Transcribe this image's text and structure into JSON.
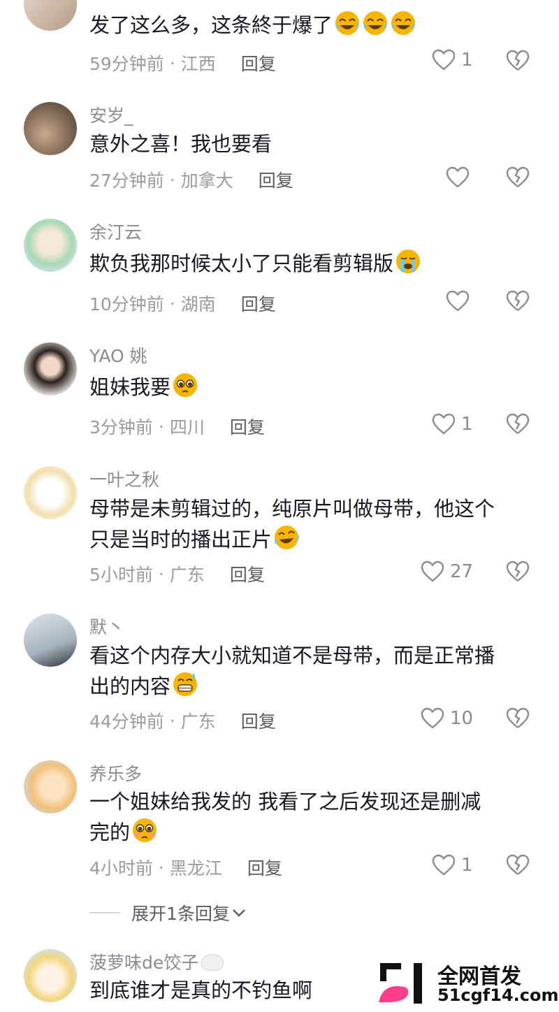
{
  "comments": [
    {
      "name": "",
      "text": "发了这么多，这条終于爆了",
      "time": "59分钟前",
      "location": "江西",
      "reply": "回复",
      "likes": "1",
      "emojis": [
        "laugh-cry",
        "laugh-cry",
        "laugh-cry"
      ]
    },
    {
      "name": "安岁_",
      "text": "意外之喜！我也要看",
      "time": "27分钟前",
      "location": "加拿大",
      "reply": "回复",
      "likes": "",
      "emojis": []
    },
    {
      "name": "余汀云",
      "text": "欺负我那时候太小了只能看剪辑版",
      "time": "10分钟前",
      "location": "湖南",
      "reply": "回复",
      "likes": "",
      "emojis": [
        "crying"
      ]
    },
    {
      "name": "YAO 姚",
      "text": "姐妹我要",
      "time": "3分钟前",
      "location": "四川",
      "reply": "回复",
      "likes": "1",
      "emojis": [
        "pleading"
      ]
    },
    {
      "name": "一叶之秋",
      "text_lines": [
        "母带是未剪辑过的，纯原片叫做母带，他这个",
        "只是当时的播出正片"
      ],
      "time": "5小时前",
      "location": "广东",
      "reply": "回复",
      "likes": "27",
      "emojis": [
        "laugh-tears"
      ]
    },
    {
      "name": "默丶",
      "text_lines": [
        "看这个内存大小就知道不是母带，而是正常播",
        "出的内容"
      ],
      "time": "44分钟前",
      "location": "广东",
      "reply": "回复",
      "likes": "10",
      "emojis": [
        "grin-sweat"
      ]
    },
    {
      "name": "养乐多",
      "text_lines": [
        "一个姐妹给我发的  我看了之后发现还是删减",
        "完的"
      ],
      "time": "4小时前",
      "location": "黑龙江",
      "reply": "回复",
      "likes": "1",
      "emojis": [
        "crying-blush"
      ]
    },
    {
      "name": "菠萝味de饺子",
      "text": "到底谁才是真的不钓鱼啊",
      "emojis": []
    }
  ],
  "expand_replies": "展开1条回复",
  "watermark": {
    "line1": "全网首发",
    "line2": "51cgf14.com"
  },
  "colors": {
    "accent_emoji": "#f7b500",
    "watermark_pink": "#ff3e8c"
  }
}
